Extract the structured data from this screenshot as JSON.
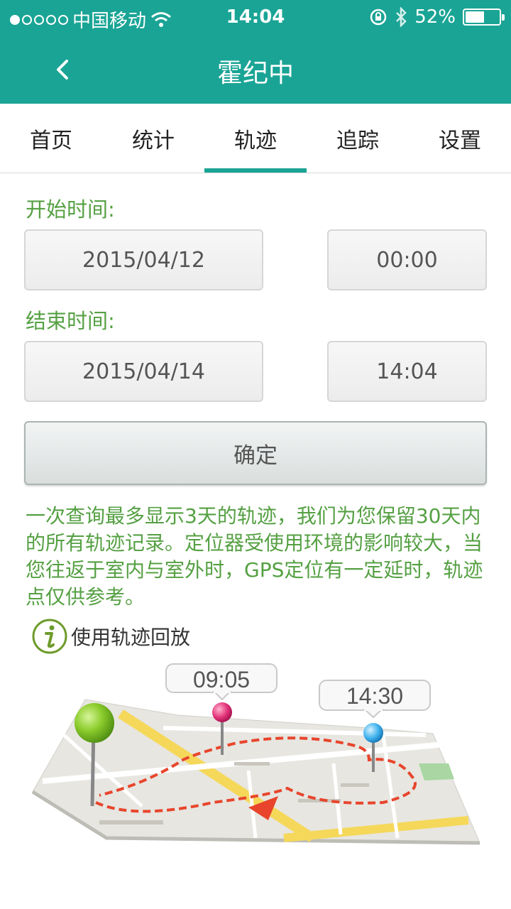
{
  "status_bar": {
    "carrier": "中国移动",
    "time": "14:04",
    "battery_percent": "52%"
  },
  "nav": {
    "title": "霍纪中"
  },
  "tabs": [
    {
      "label": "首页",
      "active": false
    },
    {
      "label": "统计",
      "active": false
    },
    {
      "label": "轨迹",
      "active": true
    },
    {
      "label": "追踪",
      "active": false
    },
    {
      "label": "设置",
      "active": false
    }
  ],
  "form": {
    "start_label": "开始时间:",
    "start_date": "2015/04/12",
    "start_time": "00:00",
    "end_label": "结束时间:",
    "end_date": "2015/04/14",
    "end_time": "14:04",
    "confirm_label": "确定"
  },
  "notice": "一次查询最多显示3天的轨迹，我们为您保留30天内的所有轨迹记录。定位器受使用环境的影响较大，当您往返于室内与室外时，GPS定位有一定延时，轨迹点仅供参考。",
  "help": {
    "label": "使用轨迹回放"
  },
  "illustration": {
    "time1": "09:05",
    "time2": "14:30"
  },
  "colors": {
    "primary": "#1aa495",
    "green_text": "#55a043",
    "route": "#e8452c"
  }
}
